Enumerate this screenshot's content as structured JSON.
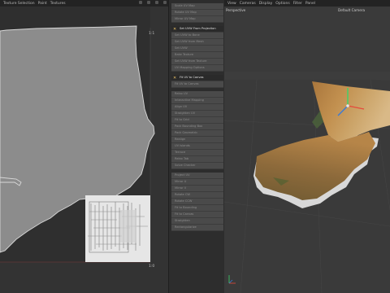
{
  "left_menu": [
    "Texture Selection",
    "Paint",
    "Textures"
  ],
  "right_menu": [
    "View",
    "Cameras",
    "Display",
    "Options",
    "Filter",
    "Panel"
  ],
  "uv": {
    "corner_top": "1:1",
    "corner_bottom": "1:0"
  },
  "side_panel": {
    "groups": [
      {
        "items": [
          "Scale UV Map",
          "Rotate UV Map",
          "Mirror UV Map"
        ]
      },
      {
        "header": "Set UVW From Projection",
        "items": [
          "Set UVW to Bone",
          "Set UVW from Mesh",
          "Set UVW",
          "Bake Texture",
          "Set UVW from Texture",
          "UV Mapping Options"
        ]
      },
      {
        "header": "Fit UV to Canvas",
        "items": [
          "Fit UV to Canvas"
        ]
      },
      {
        "items": [
          "Relax UV",
          "Interactive Mapping",
          "Align UV",
          "Straighten UV",
          "Fit to Grid",
          "Pack Bounding Box",
          "Pack Geometric",
          "Realign",
          "UV Islands",
          "Terrace",
          "Relax Tab",
          "Solve Checker"
        ]
      },
      {
        "items": [
          "Project UV",
          "Mirror U",
          "Mirror V",
          "Rotate CW",
          "Rotate CCW",
          "Fit to Bounding",
          "Fit to Canvas",
          "Straighten",
          "Rectangularize"
        ]
      }
    ]
  },
  "viewport": {
    "perspective_label": "Perspective",
    "camera_label": "Default Camera"
  },
  "colors": {
    "uv_fill": "#8c8c8c",
    "uv_stroke": "#d8d8d8",
    "bg": "#333333",
    "viewport_bg": "#3a3a3a"
  }
}
